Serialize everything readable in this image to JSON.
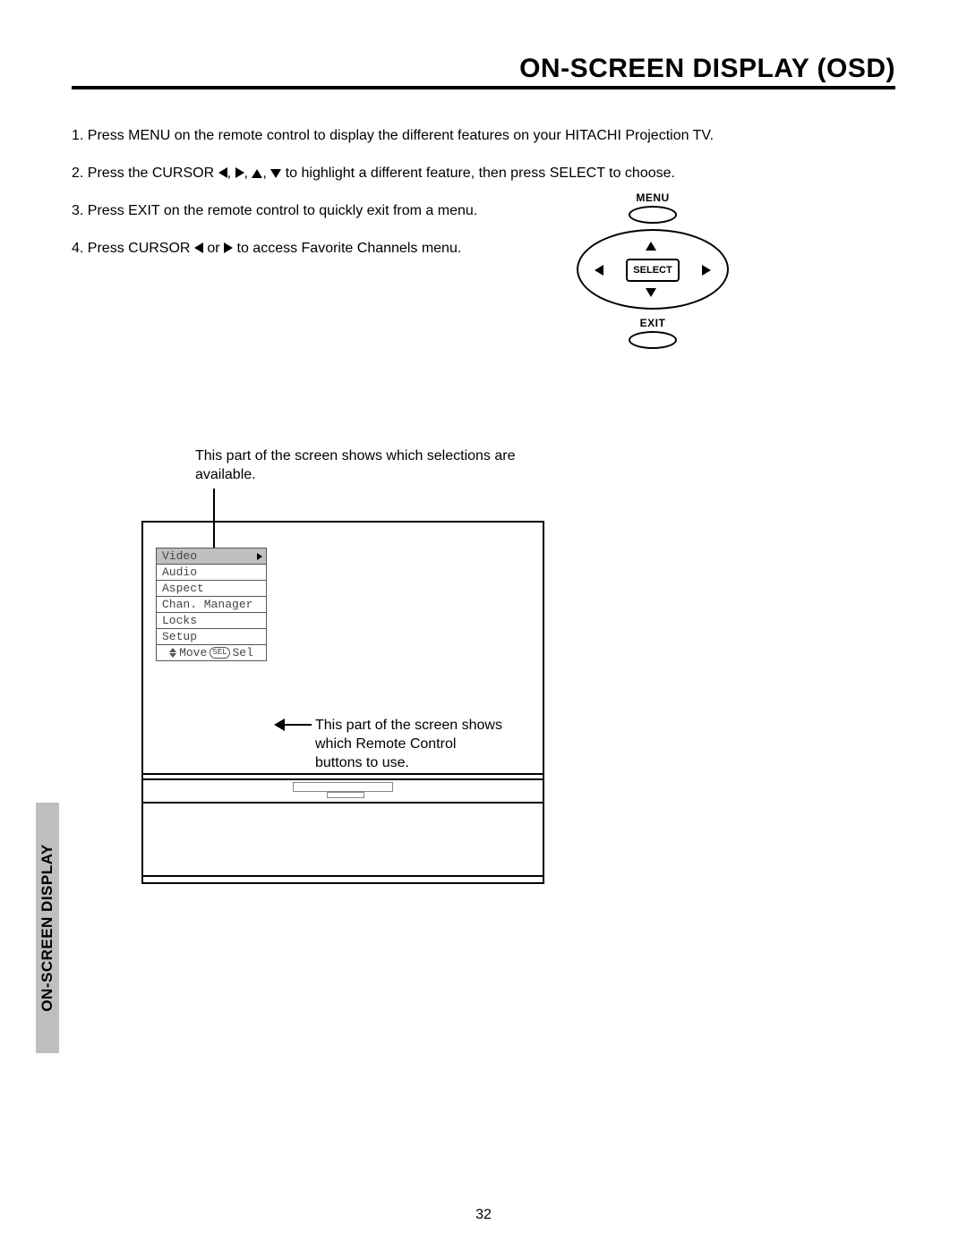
{
  "title": "ON-SCREEN DISPLAY (OSD)",
  "instructions": {
    "i1": "1.  Press MENU on the remote control to display the different features on your HITACHI Projection TV.",
    "i2a": "2.  Press the CURSOR ",
    "i2b": " to highlight a different feature, then press SELECT to choose.",
    "i3": "3.  Press EXIT on the remote control to quickly exit from a menu.",
    "i4a": "4.  Press CURSOR ",
    "i4b": " or ",
    "i4c": " to access Favorite Channels menu."
  },
  "remote": {
    "menu": "MENU",
    "select": "SELECT",
    "exit": "EXIT"
  },
  "captions": {
    "top": "This part of the screen shows which selections are available.",
    "right": "This part of the screen shows which Remote Control buttons to use."
  },
  "osd": {
    "items": [
      "Video",
      "Audio",
      "Aspect",
      "Chan. Manager",
      "Locks",
      "Setup"
    ],
    "hint_move": "Move",
    "hint_sel_pill": "SEL",
    "hint_sel": "Sel"
  },
  "sideTab": "ON-SCREEN DISPLAY",
  "pageNumber": "32"
}
